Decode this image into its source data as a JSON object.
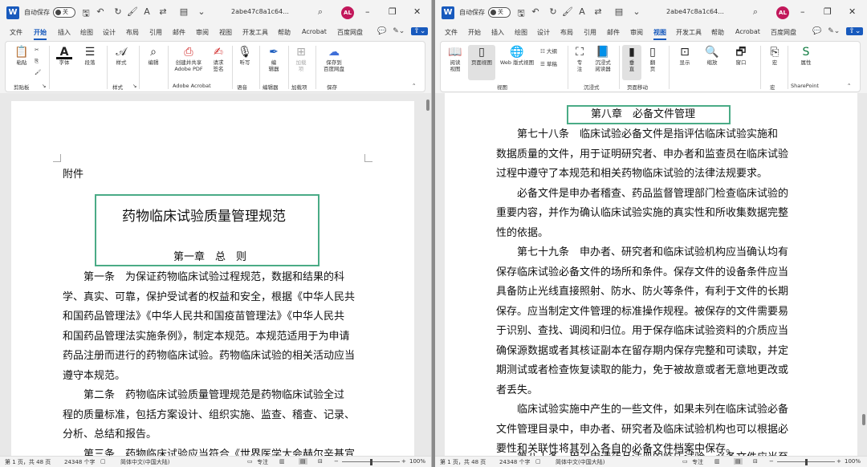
{
  "left": {
    "autosave_label": "自动保存",
    "toggle_state": "关",
    "doc_name": "2abe47c8a1c64...",
    "avatar": "AL",
    "tabs": [
      "文件",
      "开始",
      "插入",
      "绘图",
      "设计",
      "布局",
      "引用",
      "邮件",
      "审阅",
      "视图",
      "开发工具",
      "帮助",
      "Acrobat",
      "百度网盘"
    ],
    "active_tab": "开始",
    "ribbon": {
      "paste": "粘贴",
      "group_clipboard": "剪贴板",
      "font": "字体",
      "paragraph": "段落",
      "styles": "样式",
      "group_styles": "样式",
      "edit": "编辑",
      "adobe": "创建并共享\nAdobe PDF",
      "sign": "请求\n签名",
      "group_adobe": "Adobe Acrobat",
      "dictate": "听写",
      "group_voice": "语音",
      "editor": "编\n辑器",
      "group_editor": "编辑器",
      "addins": "加载\n项",
      "group_addins": "加载项",
      "save_baidu": "保存到\n百度网盘",
      "group_save": "保存"
    },
    "doc": {
      "attachment": "附件",
      "title": "药物临床试验质量管理规范",
      "chapter": "第一章　总　则",
      "p1": [
        "第一条　为保证药物临床试验过程规范，数据和结果的科",
        "学、真实、可靠，保护受试者的权益和安全，根据《中华人民共",
        "和国药品管理法》《中华人民共和国疫苗管理法》《中华人民共",
        "和国药品管理法实施条例》，制定本规范。本规范适用于为申请",
        "药品注册而进行的药物临床试验。药物临床试验的相关活动应当",
        "遵守本规范。"
      ],
      "p2": [
        "第二条　药物临床试验质量管理规范是药物临床试验全过",
        "程的质量标准，包括方案设计、组织实施、监查、稽查、记录、",
        "分析、总结和报告。"
      ],
      "p3": [
        "第三条　药物临床试验应当符合《世界医学大会赫尔辛基宣"
      ]
    },
    "status": {
      "page": "第 1 页，共 48 页",
      "words": "24348 个字",
      "lang": "简体中文(中国大陆)",
      "focus": "专注",
      "zoom": "100%"
    }
  },
  "right": {
    "autosave_label": "自动保存",
    "toggle_state": "关",
    "doc_name": "2abe47c8a1c64...",
    "avatar": "AL",
    "tabs": [
      "文件",
      "开始",
      "插入",
      "绘图",
      "设计",
      "布局",
      "引用",
      "邮件",
      "审阅",
      "视图",
      "开发工具",
      "帮助",
      "Acrobat",
      "百度网盘"
    ],
    "active_tab": "视图",
    "ribbon": {
      "read": "阅读\n视图",
      "print": "页面视图",
      "web": "Web 版式视图",
      "outline": "大纲",
      "draft": "草稿",
      "group_views": "视图",
      "focus": "专\n注",
      "immersive": "沉浸式\n阅读器",
      "group_immersive": "沉浸式",
      "vertical": "垂\n直",
      "side": "翻\n页",
      "group_pagemove": "页面移动",
      "show": "显示",
      "zoom": "缩放",
      "window": "窗口",
      "macros": "宏",
      "group_macros": "宏",
      "properties": "属性",
      "group_sp": "SharePoint"
    },
    "doc": {
      "chapter": "第八章　必备文件管理",
      "p1": [
        "第七十八条　临床试验必备文件是指评估临床试验实施和",
        "数据质量的文件，用于证明研究者、申办者和监查员在临床试验",
        "过程中遵守了本规范和相关药物临床试验的法律法规要求。"
      ],
      "p2": [
        "必备文件是申办者稽查、药品监督管理部门检查临床试验的",
        "重要内容，并作为确认临床试验实施的真实性和所收集数据完整",
        "性的依据。"
      ],
      "p3": [
        "第七十九条　申办者、研究者和临床试验机构应当确认均有",
        "保存临床试验必备文件的场所和条件。保存文件的设备条件应当",
        "具备防止光线直接照射、防水、防火等条件，有利于文件的长期",
        "保存。应当制定文件管理的标准操作规程。被保存的文件需要易",
        "于识别、查找、调阅和归位。用于保存临床试验资料的介质应当",
        "确保源数据或者其核证副本在留存期内保存完整和可读取，并定",
        "期测试或者检查恢复读取的能力，免于被故意或者无意地更改或",
        "者丢失。"
      ],
      "p4": [
        "临床试验实施中产生的一些文件，如果未列在临床试验必备",
        "文件管理目录中，申办者、研究者及临床试验机构也可以根据必",
        "要性和关联性将其列入各自的必备文件档案中保存。"
      ],
      "p5": [
        "第八十条　用于申请药品注册的临床试验，必备文件应当至"
      ]
    },
    "status": {
      "page": "第 1 页，共 48 页",
      "words": "24348 个字",
      "lang": "简体中文(中国大陆)",
      "focus": "专注",
      "zoom": "100%"
    }
  }
}
